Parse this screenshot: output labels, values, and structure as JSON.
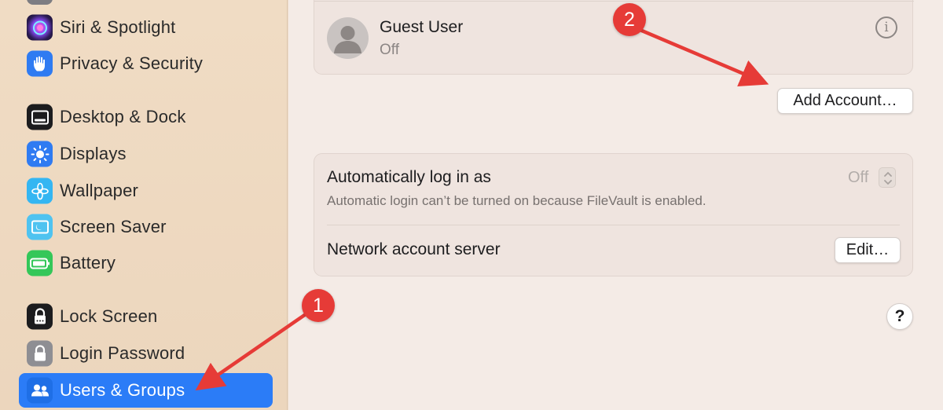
{
  "sidebar": {
    "items": [
      {
        "label": "Siri & Spotlight",
        "icon": "siri-icon"
      },
      {
        "label": "Privacy & Security",
        "icon": "hand-icon"
      },
      {
        "label": "Desktop & Dock",
        "icon": "dock-icon"
      },
      {
        "label": "Displays",
        "icon": "sun-icon"
      },
      {
        "label": "Wallpaper",
        "icon": "flower-icon"
      },
      {
        "label": "Screen Saver",
        "icon": "screen-saver-icon"
      },
      {
        "label": "Battery",
        "icon": "battery-icon"
      },
      {
        "label": "Lock Screen",
        "icon": "lock-icon"
      },
      {
        "label": "Login Password",
        "icon": "padlock-icon"
      },
      {
        "label": "Users & Groups",
        "icon": "users-icon",
        "selected": true
      }
    ]
  },
  "users": {
    "guest": {
      "name": "Guest User",
      "status": "Off"
    },
    "add_account_label": "Add Account…"
  },
  "login": {
    "auto_login_title": "Automatically log in as",
    "auto_login_value": "Off",
    "auto_login_note": "Automatic login can’t be turned on because FileVault is enabled.",
    "network_server_title": "Network account server",
    "edit_label": "Edit…"
  },
  "help_label": "?",
  "annotations": {
    "step1": "1",
    "step2": "2"
  },
  "colors": {
    "accent": "#2b7cf7",
    "annotation": "#e63b37"
  }
}
